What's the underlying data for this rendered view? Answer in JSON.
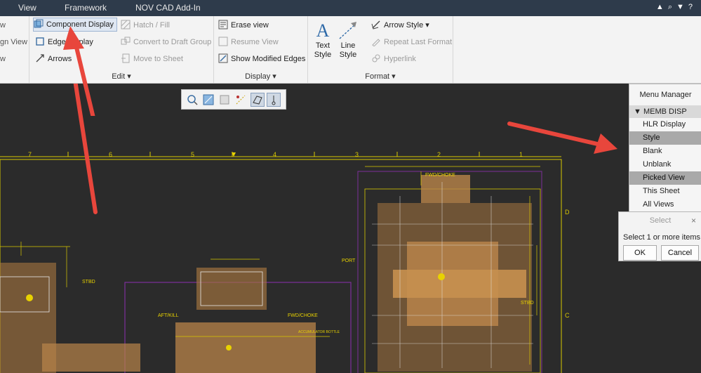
{
  "tabs": [
    "View",
    "Framework",
    "NOV CAD Add-In"
  ],
  "ribbon": {
    "cut_off": {
      "row1": "w",
      "row2": "gn View",
      "row3": "w"
    },
    "edit": {
      "component_display": "Component Display",
      "edge_display": "Edge Display",
      "arrows": "Arrows",
      "hatch_fill": "Hatch / Fill",
      "convert_to_draft_group": "Convert to Draft Group",
      "move_to_sheet": "Move to Sheet",
      "label": "Edit"
    },
    "display": {
      "erase_view": "Erase view",
      "resume_view": "Resume View",
      "show_modified_edges": "Show Modified Edges",
      "label": "Display"
    },
    "format": {
      "text_style_1": "Text",
      "text_style_2": "Style",
      "line_style_1": "Line",
      "line_style_2": "Style",
      "arrow_style": "Arrow Style",
      "repeat_last_format": "Repeat Last Format",
      "hyperlink": "Hyperlink",
      "label": "Format"
    }
  },
  "drawing": {
    "zone_numbers": [
      "7",
      "6",
      "5",
      "4",
      "3",
      "2",
      "1"
    ],
    "zone_letters": [
      "D",
      "C"
    ],
    "labels": {
      "fwd_choke_top": "FWD/CHOKE",
      "stbd_left": "STBD",
      "aft_kill": "AFT/KILL",
      "fwd_choke_mid": "FWD/CHOKE",
      "port": "PORT",
      "stbd_right": "STBD",
      "accumulator": "ACCUMULATOR BOTTLE"
    }
  },
  "menu_manager": {
    "title": "Menu Manager",
    "section": "MEMB DISP",
    "items": [
      "HLR Display",
      "Style",
      "Blank",
      "Unblank",
      "Picked View",
      "This Sheet",
      "All Views"
    ],
    "highlighted": [
      "Style",
      "Picked View"
    ]
  },
  "select_dialog": {
    "title": "Select",
    "close": "×",
    "message": "Select 1 or more items.",
    "ok": "OK",
    "cancel": "Cancel"
  },
  "colors": {
    "tabbar": "#2e3b4b",
    "ribbon": "#f3f3f3",
    "canvas": "#2b2b2b",
    "drawing_yellow": "#e8d200",
    "drawing_brown": "#b9844a",
    "arrow_red": "#e8463c"
  }
}
